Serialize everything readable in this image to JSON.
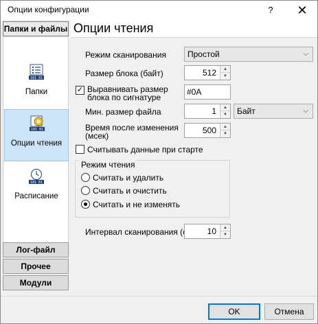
{
  "window": {
    "title": "Опции конфигурации",
    "help_label": "?",
    "close_label": "✕"
  },
  "left_nav": {
    "group_top": "Папки и файлы",
    "items": [
      {
        "label": "Папки",
        "icon": "folders-icon"
      },
      {
        "label": "Опции чтения",
        "icon": "reading-options-icon",
        "selected": true
      },
      {
        "label": "Расписание",
        "icon": "schedule-icon"
      }
    ],
    "groups_bottom": [
      "Лог-файл",
      "Прочее",
      "Модули"
    ]
  },
  "section": {
    "title": "Опции чтения"
  },
  "form": {
    "scan_mode": {
      "label": "Режим сканирования",
      "value": "Простой"
    },
    "block_size": {
      "label": "Размер блока (байт)",
      "value": "512"
    },
    "align_block": {
      "label": "Выравнивать размер блока по сигнатуре",
      "checked": true,
      "value": "#0A"
    },
    "min_file_size": {
      "label": "Мин. размер файла",
      "value": "1",
      "unit": "Байт"
    },
    "time_after_change": {
      "label": "Время после изменения (мсек)",
      "value": "500"
    },
    "read_on_start": {
      "label": "Считывать данные при старте",
      "checked": false
    },
    "read_mode": {
      "title": "Режим чтения",
      "options": [
        "Считать и удалить",
        "Считать и очистить",
        "Считать и не изменять"
      ],
      "selected_index": 2
    },
    "scan_interval": {
      "label": "Интервал сканирования (сек)",
      "value": "10"
    }
  },
  "footer": {
    "ok_label": "OK",
    "cancel_label": "Отмена"
  }
}
